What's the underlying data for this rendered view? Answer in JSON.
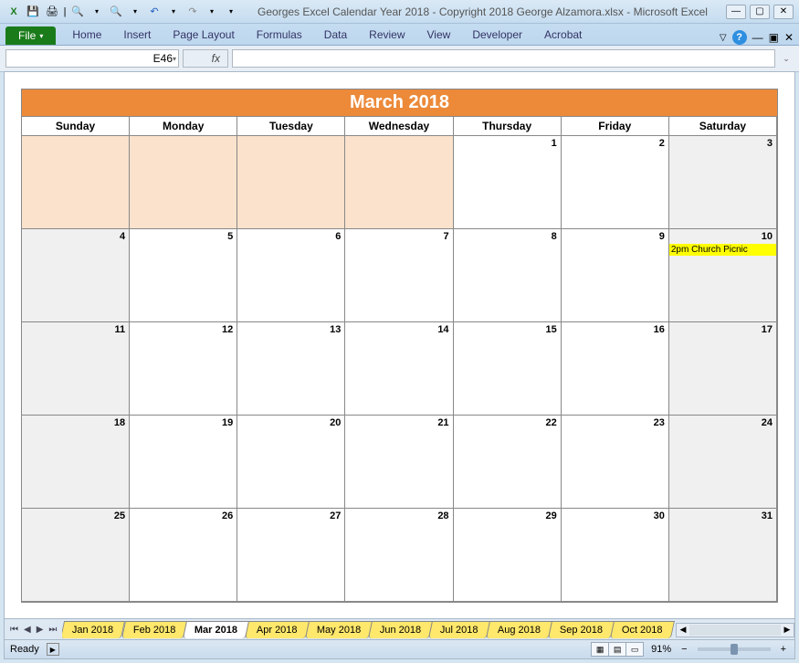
{
  "titlebar": {
    "title": "Georges Excel Calendar Year 2018  -  Copyright 2018 George Alzamora.xlsx  -  Microsoft Excel"
  },
  "ribbon": {
    "file": "File",
    "tabs": [
      "Home",
      "Insert",
      "Page Layout",
      "Formulas",
      "Data",
      "Review",
      "View",
      "Developer",
      "Acrobat"
    ]
  },
  "namebox": "E46",
  "fx": "fx",
  "calendar": {
    "title": "March 2018",
    "days": [
      "Sunday",
      "Monday",
      "Tuesday",
      "Wednesday",
      "Thursday",
      "Friday",
      "Saturday"
    ],
    "cells": [
      {
        "num": "",
        "cls": "prev"
      },
      {
        "num": "",
        "cls": "prev"
      },
      {
        "num": "",
        "cls": "prev"
      },
      {
        "num": "",
        "cls": "prev"
      },
      {
        "num": "1",
        "cls": ""
      },
      {
        "num": "2",
        "cls": ""
      },
      {
        "num": "3",
        "cls": "weekend"
      },
      {
        "num": "4",
        "cls": "weekend"
      },
      {
        "num": "5",
        "cls": ""
      },
      {
        "num": "6",
        "cls": ""
      },
      {
        "num": "7",
        "cls": ""
      },
      {
        "num": "8",
        "cls": ""
      },
      {
        "num": "9",
        "cls": ""
      },
      {
        "num": "10",
        "cls": "weekend",
        "ev": "2pm Church Picnic"
      },
      {
        "num": "11",
        "cls": "weekend"
      },
      {
        "num": "12",
        "cls": ""
      },
      {
        "num": "13",
        "cls": ""
      },
      {
        "num": "14",
        "cls": ""
      },
      {
        "num": "15",
        "cls": ""
      },
      {
        "num": "16",
        "cls": ""
      },
      {
        "num": "17",
        "cls": "weekend"
      },
      {
        "num": "18",
        "cls": "weekend"
      },
      {
        "num": "19",
        "cls": ""
      },
      {
        "num": "20",
        "cls": ""
      },
      {
        "num": "21",
        "cls": ""
      },
      {
        "num": "22",
        "cls": ""
      },
      {
        "num": "23",
        "cls": ""
      },
      {
        "num": "24",
        "cls": "weekend"
      },
      {
        "num": "25",
        "cls": "weekend"
      },
      {
        "num": "26",
        "cls": ""
      },
      {
        "num": "27",
        "cls": ""
      },
      {
        "num": "28",
        "cls": ""
      },
      {
        "num": "29",
        "cls": ""
      },
      {
        "num": "30",
        "cls": ""
      },
      {
        "num": "31",
        "cls": "weekend"
      }
    ]
  },
  "sheets": {
    "tabs": [
      {
        "label": "Jan 2018",
        "active": false
      },
      {
        "label": "Feb 2018",
        "active": false
      },
      {
        "label": "Mar 2018",
        "active": true
      },
      {
        "label": "Apr 2018",
        "active": false
      },
      {
        "label": "May 2018",
        "active": false
      },
      {
        "label": "Jun 2018",
        "active": false
      },
      {
        "label": "Jul 2018",
        "active": false
      },
      {
        "label": "Aug 2018",
        "active": false
      },
      {
        "label": "Sep 2018",
        "active": false
      },
      {
        "label": "Oct 2018",
        "active": false
      }
    ]
  },
  "status": {
    "ready": "Ready",
    "zoom": "91%"
  }
}
